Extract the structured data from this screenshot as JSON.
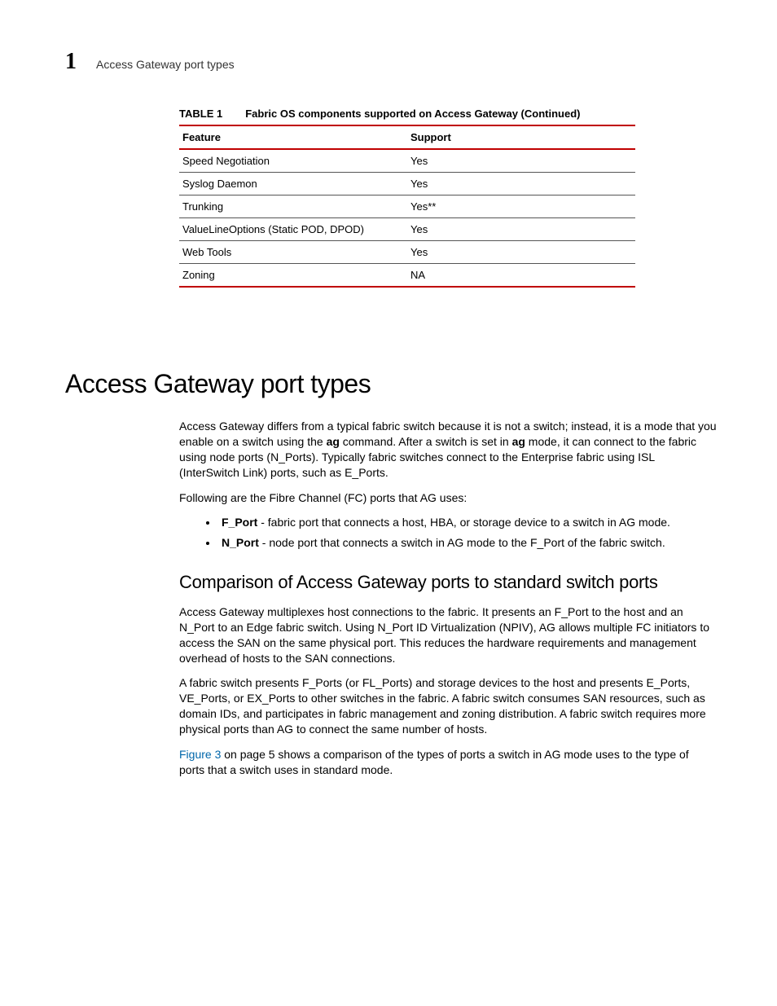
{
  "header": {
    "chapter_number": "1",
    "running_title": "Access Gateway port types"
  },
  "table": {
    "label": "TABLE 1",
    "caption": "Fabric OS components supported on Access Gateway (Continued)",
    "columns": [
      "Feature",
      "Support"
    ],
    "rows": [
      {
        "feature": "Speed Negotiation",
        "support": "Yes"
      },
      {
        "feature": "Syslog Daemon",
        "support": "Yes"
      },
      {
        "feature": "Trunking",
        "support": "Yes**"
      },
      {
        "feature": "ValueLineOptions (Static POD, DPOD)",
        "support": "Yes"
      },
      {
        "feature": "Web Tools",
        "support": "Yes"
      },
      {
        "feature": "Zoning",
        "support": "NA"
      }
    ]
  },
  "section": {
    "heading": "Access Gateway port types",
    "para1_pre": "Access Gateway differs from a typical fabric switch because it is not a switch; instead, it is a mode that you enable on a switch using the ",
    "para1_cmd1": "ag",
    "para1_mid": " command. After a switch is set in ",
    "para1_cmd2": "ag",
    "para1_post": " mode, it can connect to the fabric using node ports (N_Ports). Typically fabric switches connect to the Enterprise fabric using ISL (InterSwitch Link) ports, such as E_Ports.",
    "para2": "Following are the Fibre Channel (FC) ports that AG uses:",
    "bullets": [
      {
        "term": "F_Port",
        "desc": " - fabric port that connects a host, HBA, or storage device to a switch in AG mode."
      },
      {
        "term": "N_Port",
        "desc": " - node port that connects a switch in AG mode to the F_Port of the fabric switch."
      }
    ],
    "subheading": "Comparison of Access Gateway ports to standard switch ports",
    "para3": "Access Gateway multiplexes host connections to the fabric. It presents an F_Port to the host and an N_Port to an Edge fabric switch. Using N_Port ID Virtualization (NPIV), AG allows multiple FC initiators to access the SAN on the same physical port. This reduces the hardware requirements and management overhead of hosts to the SAN connections.",
    "para4": "A fabric switch presents F_Ports (or FL_Ports) and storage devices to the host and presents E_Ports, VE_Ports, or EX_Ports to other switches in the fabric. A fabric switch consumes SAN resources, such as domain IDs, and participates in fabric management and zoning distribution. A fabric switch requires more physical ports than AG to connect the same number of hosts.",
    "para5_xref": "Figure 3",
    "para5_rest": " on page 5 shows a comparison of the types of ports a switch in AG mode uses to the type of ports that a switch uses in standard mode."
  }
}
